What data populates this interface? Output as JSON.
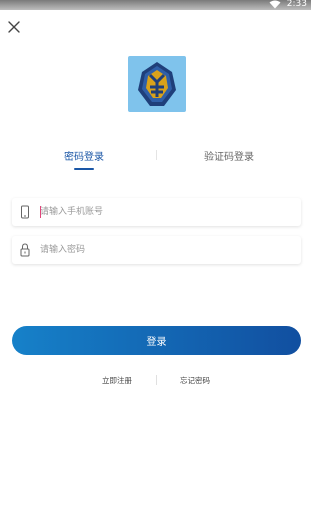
{
  "status_bar": {
    "time": "2:33",
    "wifi_icon": "wifi-icon"
  },
  "close_icon": "close-icon",
  "logo_icon": "app-logo-icon",
  "tabs": [
    {
      "label": "密码登录",
      "active": true
    },
    {
      "label": "验证码登录",
      "active": false
    }
  ],
  "form": {
    "phone_placeholder": "请输入手机账号",
    "phone_icon": "phone-icon",
    "password_placeholder": "请输入密码",
    "password_icon": "lock-icon"
  },
  "login_button": "登录",
  "links": {
    "register": "立即注册",
    "forgot": "忘记密码"
  },
  "colors": {
    "accent": "#1a56a6",
    "button_start": "#1681c9",
    "button_end": "#114fa0",
    "logo_bg": "#7fc3ec"
  }
}
